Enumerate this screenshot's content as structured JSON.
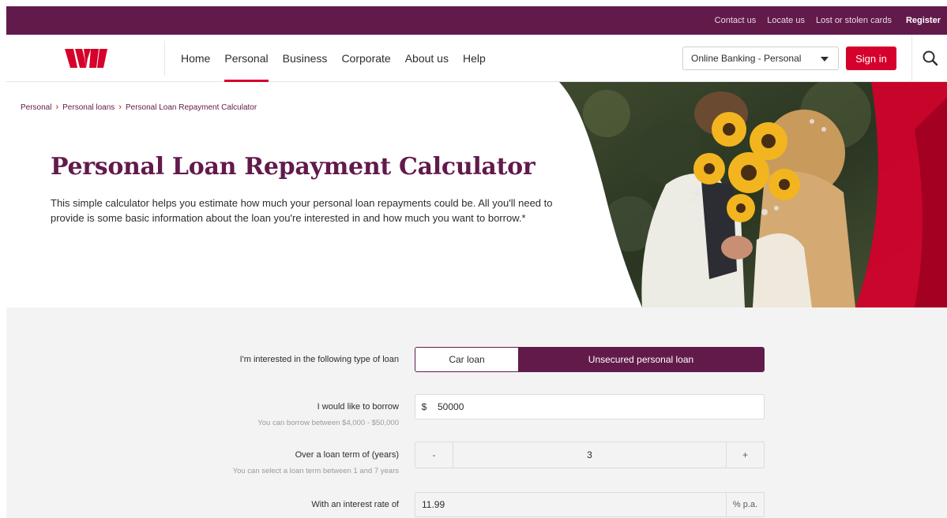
{
  "colors": {
    "brand": "#621a4b",
    "accent": "#d5002b",
    "background": "#f3f3f3"
  },
  "utility_bar": {
    "links": [
      "Contact us",
      "Locate us",
      "Lost or stolen cards"
    ],
    "register": "Register"
  },
  "header": {
    "logo_icon": "westpac-w-logo",
    "nav": [
      "Home",
      "Personal",
      "Business",
      "Corporate",
      "About us",
      "Help"
    ],
    "active_nav": "Personal",
    "online_banking_select": "Online Banking - Personal",
    "sign_in": "Sign in",
    "search_icon": "search-icon"
  },
  "breadcrumb": [
    "Personal",
    "Personal loans",
    "Personal Loan Repayment Calculator"
  ],
  "hero": {
    "title": "Personal Loan Repayment Calculator",
    "description": "This simple calculator helps you estimate how much your personal loan repayments could be. All you'll need to provide is some basic information about the loan you're interested in and how much you want to borrow.*"
  },
  "calculator": {
    "loan_type": {
      "label": "I'm interested in the following type of loan",
      "options": [
        "Car loan",
        "Unsecured personal loan"
      ],
      "selected": "Unsecured personal loan"
    },
    "borrow": {
      "label": "I would like to borrow",
      "hint": "You can borrow between $4,000 - $50,000",
      "currency": "$",
      "value": "50000"
    },
    "term": {
      "label": "Over a loan term of (years)",
      "hint": "You can select a loan term between 1 and 7 years",
      "minus": "-",
      "value": "3",
      "plus": "+"
    },
    "rate": {
      "label": "With an interest rate of",
      "value": "11.99",
      "unit": "% p.a."
    }
  }
}
